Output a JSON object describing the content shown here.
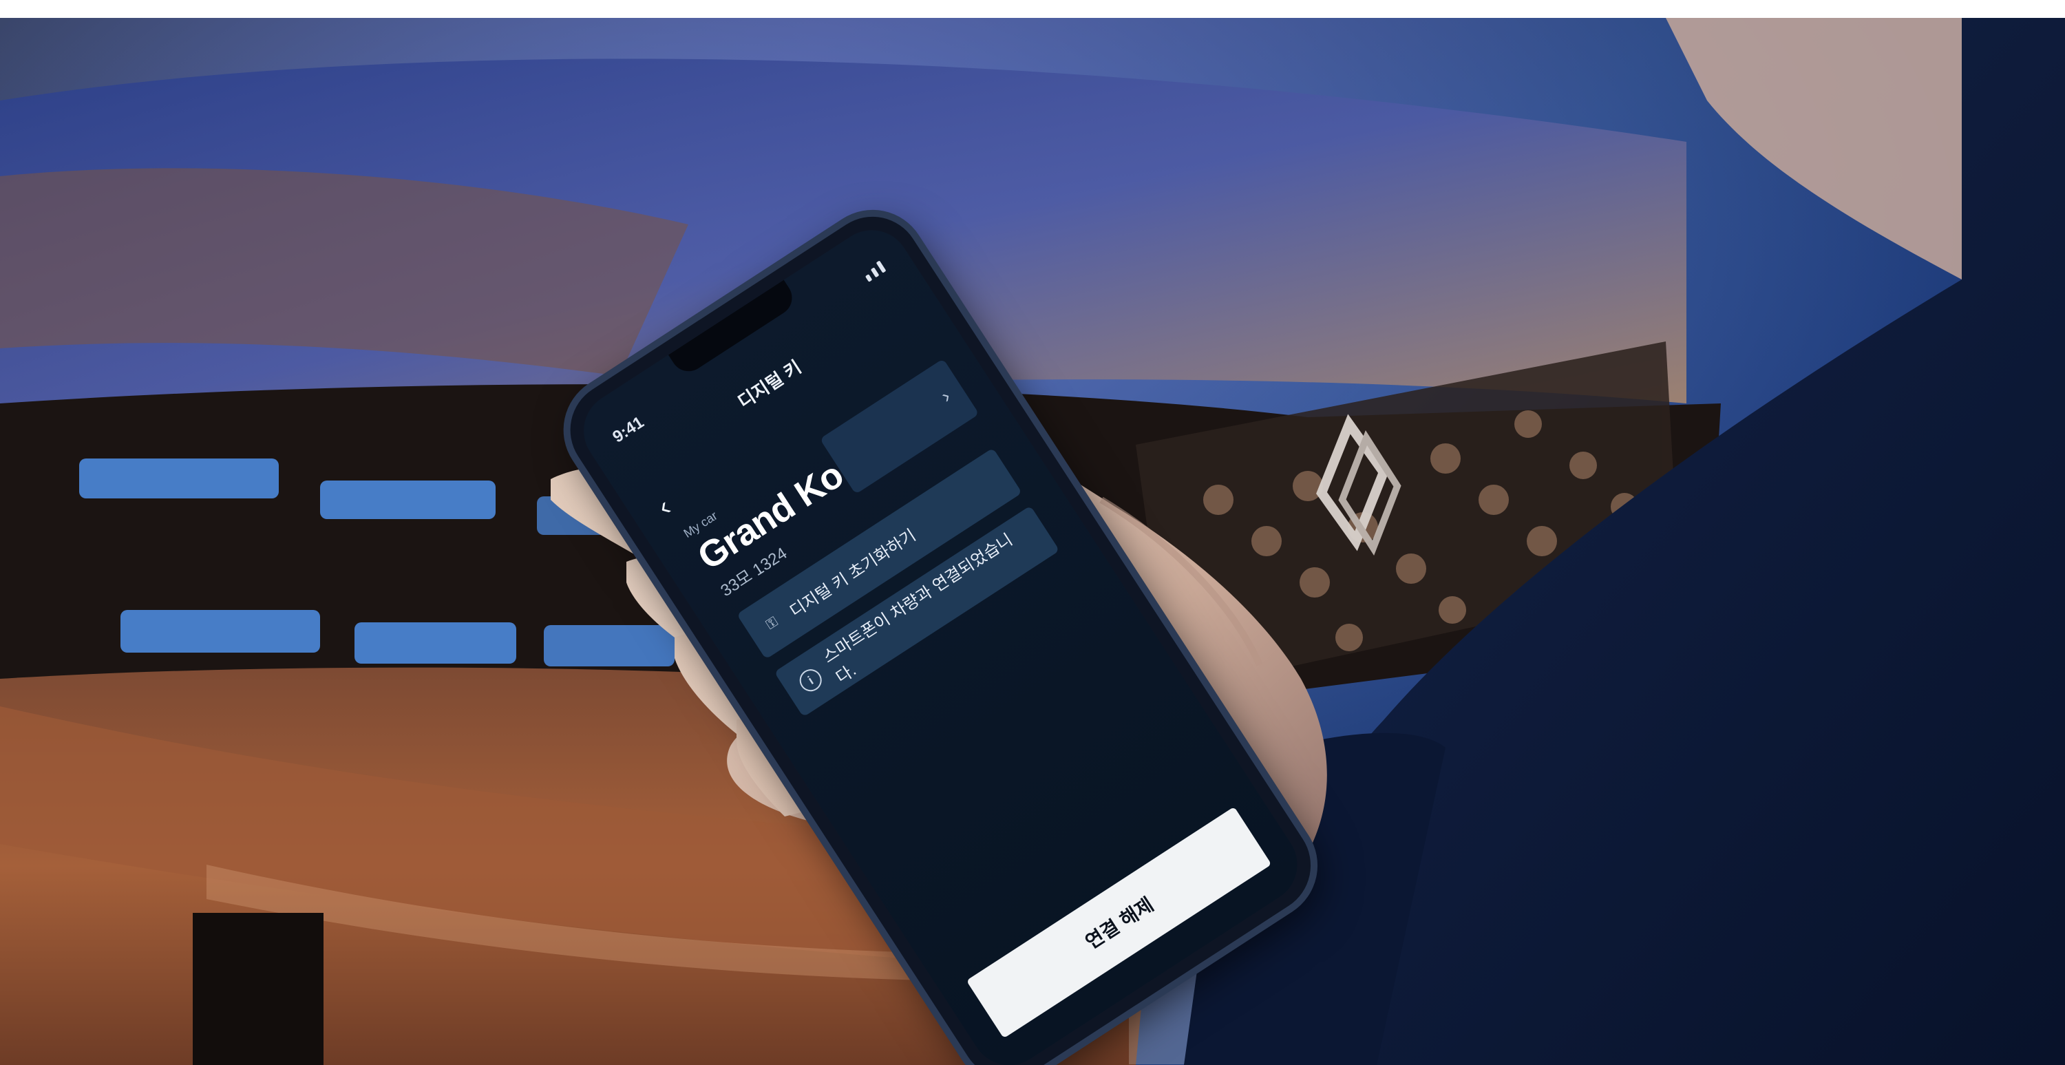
{
  "photo": {
    "status_time": "9:41",
    "nav_title": "디지털 키",
    "back_icon": "chevron-left-icon",
    "section_label": "My car",
    "car_name": "Grand Koleos",
    "plate": "33모 1324",
    "menu": [
      {
        "label": "",
        "icon": "chevron-right-icon"
      },
      {
        "label": "디지털 키 초기화하기",
        "icon": "key-icon"
      },
      {
        "label": "스마트폰이 차량과 연결되었습니다.",
        "icon": "info-icon"
      }
    ],
    "cta_label": "연결 해제"
  },
  "colors": {
    "car_body": "#9a5a36",
    "car_highlight": "#d6a07c",
    "light_bar": "#4f8fe8",
    "background_blue": "#1d3e7a",
    "jacket": "#0c1a36",
    "skin": "#d8c1b2"
  }
}
